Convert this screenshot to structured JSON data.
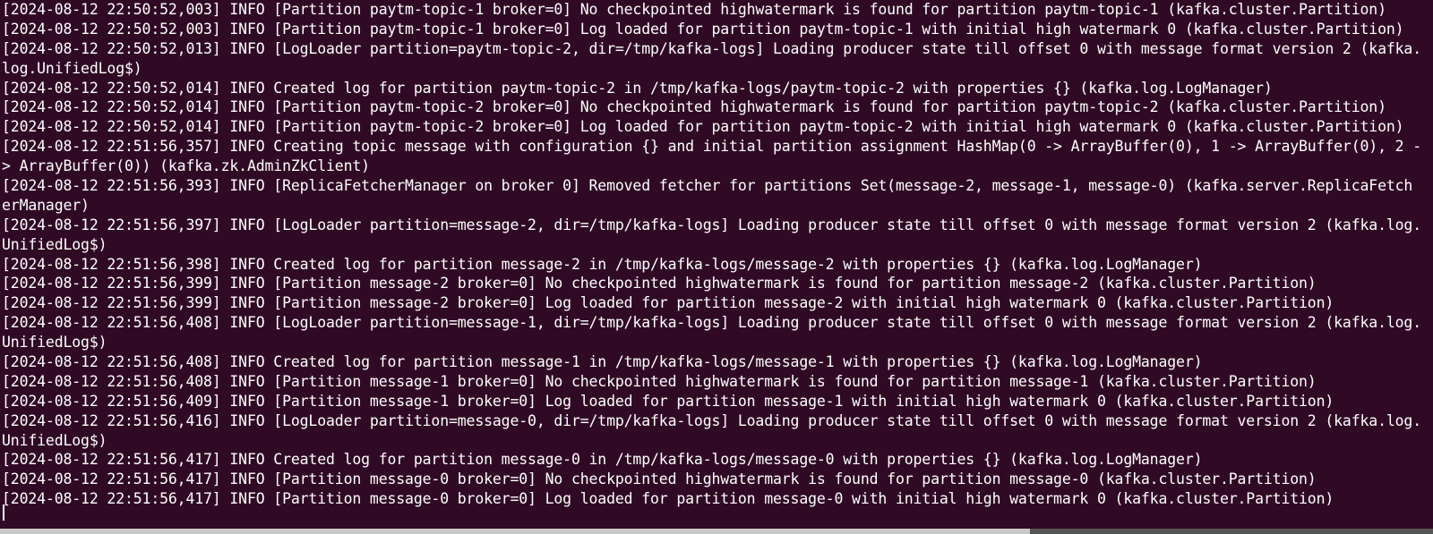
{
  "window": {
    "app": "Terminal"
  },
  "terminal": {
    "lines": [
      "[2024-08-12 22:50:52,003] INFO [Partition paytm-topic-1 broker=0] No checkpointed highwatermark is found for partition paytm-topic-1 (kafka.cluster.Partition)",
      "[2024-08-12 22:50:52,003] INFO [Partition paytm-topic-1 broker=0] Log loaded for partition paytm-topic-1 with initial high watermark 0 (kafka.cluster.Partition)",
      "[2024-08-12 22:50:52,013] INFO [LogLoader partition=paytm-topic-2, dir=/tmp/kafka-logs] Loading producer state till offset 0 with message format version 2 (kafka.",
      "log.UnifiedLog$)",
      "[2024-08-12 22:50:52,014] INFO Created log for partition paytm-topic-2 in /tmp/kafka-logs/paytm-topic-2 with properties {} (kafka.log.LogManager)",
      "[2024-08-12 22:50:52,014] INFO [Partition paytm-topic-2 broker=0] No checkpointed highwatermark is found for partition paytm-topic-2 (kafka.cluster.Partition)",
      "[2024-08-12 22:50:52,014] INFO [Partition paytm-topic-2 broker=0] Log loaded for partition paytm-topic-2 with initial high watermark 0 (kafka.cluster.Partition)",
      "[2024-08-12 22:51:56,357] INFO Creating topic message with configuration {} and initial partition assignment HashMap(0 -> ArrayBuffer(0), 1 -> ArrayBuffer(0), 2 -",
      "> ArrayBuffer(0)) (kafka.zk.AdminZkClient)",
      "[2024-08-12 22:51:56,393] INFO [ReplicaFetcherManager on broker 0] Removed fetcher for partitions Set(message-2, message-1, message-0) (kafka.server.ReplicaFetch",
      "erManager)",
      "[2024-08-12 22:51:56,397] INFO [LogLoader partition=message-2, dir=/tmp/kafka-logs] Loading producer state till offset 0 with message format version 2 (kafka.log.",
      "UnifiedLog$)",
      "[2024-08-12 22:51:56,398] INFO Created log for partition message-2 in /tmp/kafka-logs/message-2 with properties {} (kafka.log.LogManager)",
      "[2024-08-12 22:51:56,399] INFO [Partition message-2 broker=0] No checkpointed highwatermark is found for partition message-2 (kafka.cluster.Partition)",
      "[2024-08-12 22:51:56,399] INFO [Partition message-2 broker=0] Log loaded for partition message-2 with initial high watermark 0 (kafka.cluster.Partition)",
      "[2024-08-12 22:51:56,408] INFO [LogLoader partition=message-1, dir=/tmp/kafka-logs] Loading producer state till offset 0 with message format version 2 (kafka.log.",
      "UnifiedLog$)",
      "[2024-08-12 22:51:56,408] INFO Created log for partition message-1 in /tmp/kafka-logs/message-1 with properties {} (kafka.log.LogManager)",
      "[2024-08-12 22:51:56,408] INFO [Partition message-1 broker=0] No checkpointed highwatermark is found for partition message-1 (kafka.cluster.Partition)",
      "[2024-08-12 22:51:56,409] INFO [Partition message-1 broker=0] Log loaded for partition message-1 with initial high watermark 0 (kafka.cluster.Partition)",
      "[2024-08-12 22:51:56,416] INFO [LogLoader partition=message-0, dir=/tmp/kafka-logs] Loading producer state till offset 0 with message format version 2 (kafka.log.",
      "UnifiedLog$)",
      "[2024-08-12 22:51:56,417] INFO Created log for partition message-0 in /tmp/kafka-logs/message-0 with properties {} (kafka.log.LogManager)",
      "[2024-08-12 22:51:56,417] INFO [Partition message-0 broker=0] No checkpointed highwatermark is found for partition message-0 (kafka.cluster.Partition)",
      "[2024-08-12 22:51:56,417] INFO [Partition message-0 broker=0] Log loaded for partition message-0 with initial high watermark 0 (kafka.cluster.Partition)"
    ]
  },
  "colors": {
    "background": "#300a24",
    "foreground": "#ffffff"
  }
}
